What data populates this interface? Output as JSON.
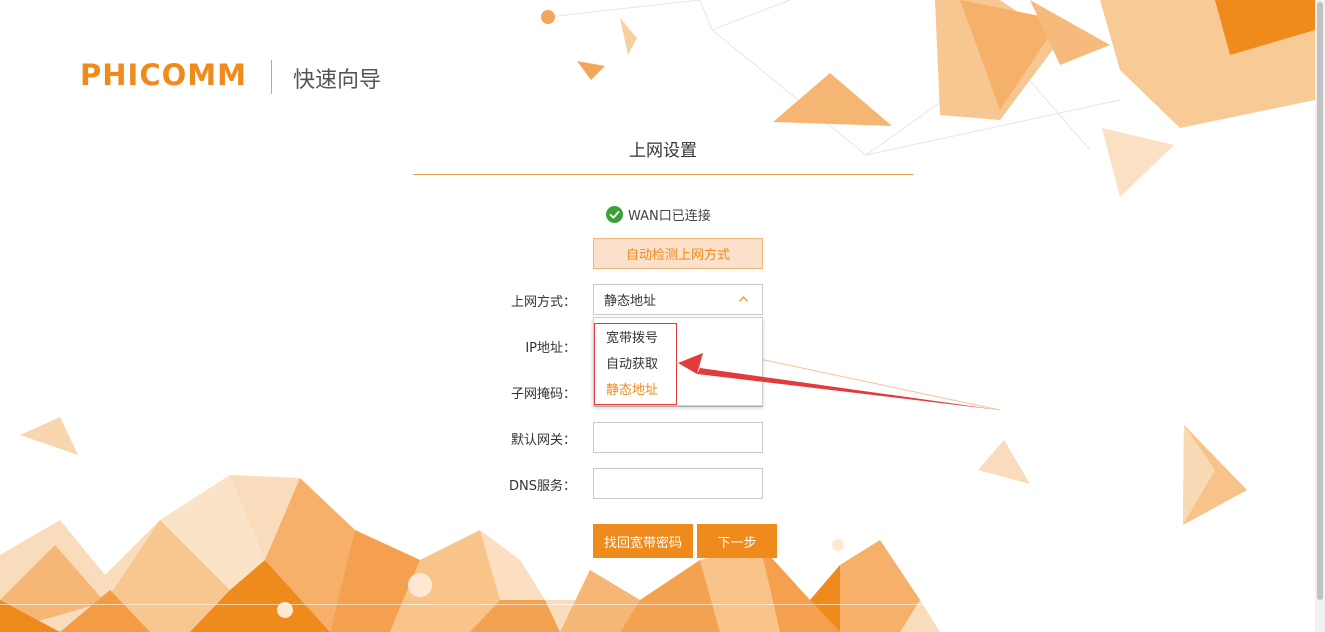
{
  "brand": {
    "logo_text": "PHICOMM",
    "wizard_title": "快速向导",
    "accent_color": "#ef8a1c"
  },
  "section": {
    "title": "上网设置"
  },
  "wan": {
    "status_text": "WAN口已连接",
    "status_icon": "check-circle-icon",
    "status_color": "#3aa03a"
  },
  "detect_button": {
    "label": "自动检测上网方式"
  },
  "form": {
    "connection_type": {
      "label": "上网方式：",
      "value": "静态地址",
      "options": [
        "宽带拨号",
        "自动获取",
        "静态地址"
      ],
      "selected_index": 2
    },
    "ip": {
      "label": "IP地址：",
      "value": ""
    },
    "subnet": {
      "label": "子网掩码：",
      "value": ""
    },
    "gateway": {
      "label": "默认网关：",
      "value": ""
    },
    "dns": {
      "label": "DNS服务：",
      "value": ""
    }
  },
  "actions": {
    "recover_password": "找回宽带密码",
    "next": "下一步"
  },
  "annotation": {
    "highlight_color": "#e23b3b"
  }
}
